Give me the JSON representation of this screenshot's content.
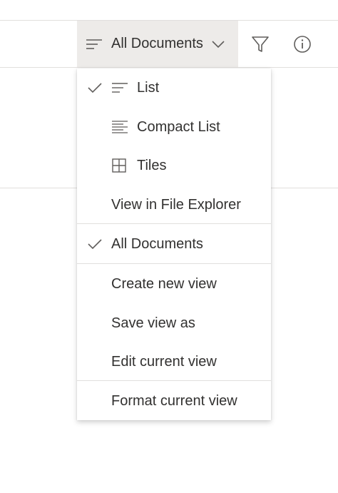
{
  "command_bar": {
    "view_label": "All Documents",
    "view_icon": "lines-icon",
    "chevron_icon": "chevron-down-icon",
    "filter_icon": "filter-icon",
    "info_icon": "info-icon"
  },
  "menu": {
    "layout_items": [
      {
        "label": "List",
        "icon": "list-icon",
        "checked": true
      },
      {
        "label": "Compact List",
        "icon": "compact-list-icon",
        "checked": false
      },
      {
        "label": "Tiles",
        "icon": "tiles-icon",
        "checked": false
      }
    ],
    "file_explorer_label": "View in File Explorer",
    "views": [
      {
        "label": "All Documents",
        "checked": true
      }
    ],
    "actions": [
      {
        "label": "Create new view"
      },
      {
        "label": "Save view as"
      },
      {
        "label": "Edit current view"
      }
    ],
    "format_label": "Format current view"
  },
  "colors": {
    "selected_bg": "#edebe9",
    "text": "#323130",
    "divider": "#e1dfdd"
  }
}
